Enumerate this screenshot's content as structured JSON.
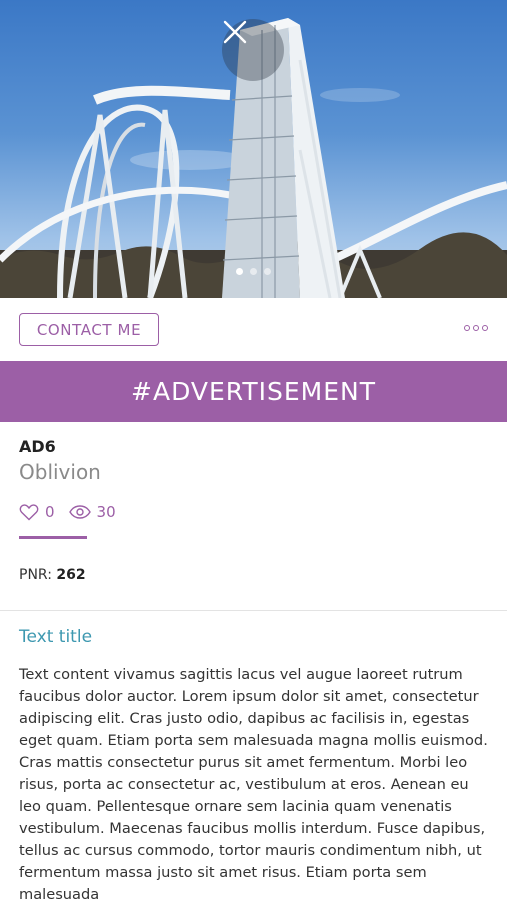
{
  "hero": {
    "image_alt": "Roller coaster",
    "close_icon": "close-icon",
    "pager_total": 3,
    "pager_active": 1
  },
  "actions": {
    "contact_label": "CONTACT ME",
    "more_icon": "more-dots-icon"
  },
  "banner": {
    "label": "#ADVERTISEMENT",
    "color": "#9c5fa6"
  },
  "ad": {
    "code": "AD6",
    "name": "Oblivion",
    "likes": "0",
    "views": "30",
    "pnr_label": "PNR:",
    "pnr_value": "262"
  },
  "content": {
    "title": "Text title",
    "body": "Text content vivamus sagittis lacus vel augue laoreet rutrum faucibus dolor auctor. Lorem ipsum dolor sit amet, consectetur adipiscing elit. Cras justo odio, dapibus ac facilisis in, egestas eget quam. Etiam porta sem malesuada magna mollis euismod. Cras mattis consectetur purus sit amet fermentum. Morbi leo risus, porta ac consectetur ac, vestibulum at eros. Aenean eu leo quam. Pellentesque ornare sem lacinia quam venenatis vestibulum. Maecenas faucibus mollis interdum. Fusce dapibus, tellus ac cursus commodo, tortor mauris condimentum nibh, ut fermentum massa justo sit amet risus. Etiam porta sem malesuada"
  },
  "colors": {
    "accent": "#9c5fa6",
    "title": "#3d98b0"
  }
}
